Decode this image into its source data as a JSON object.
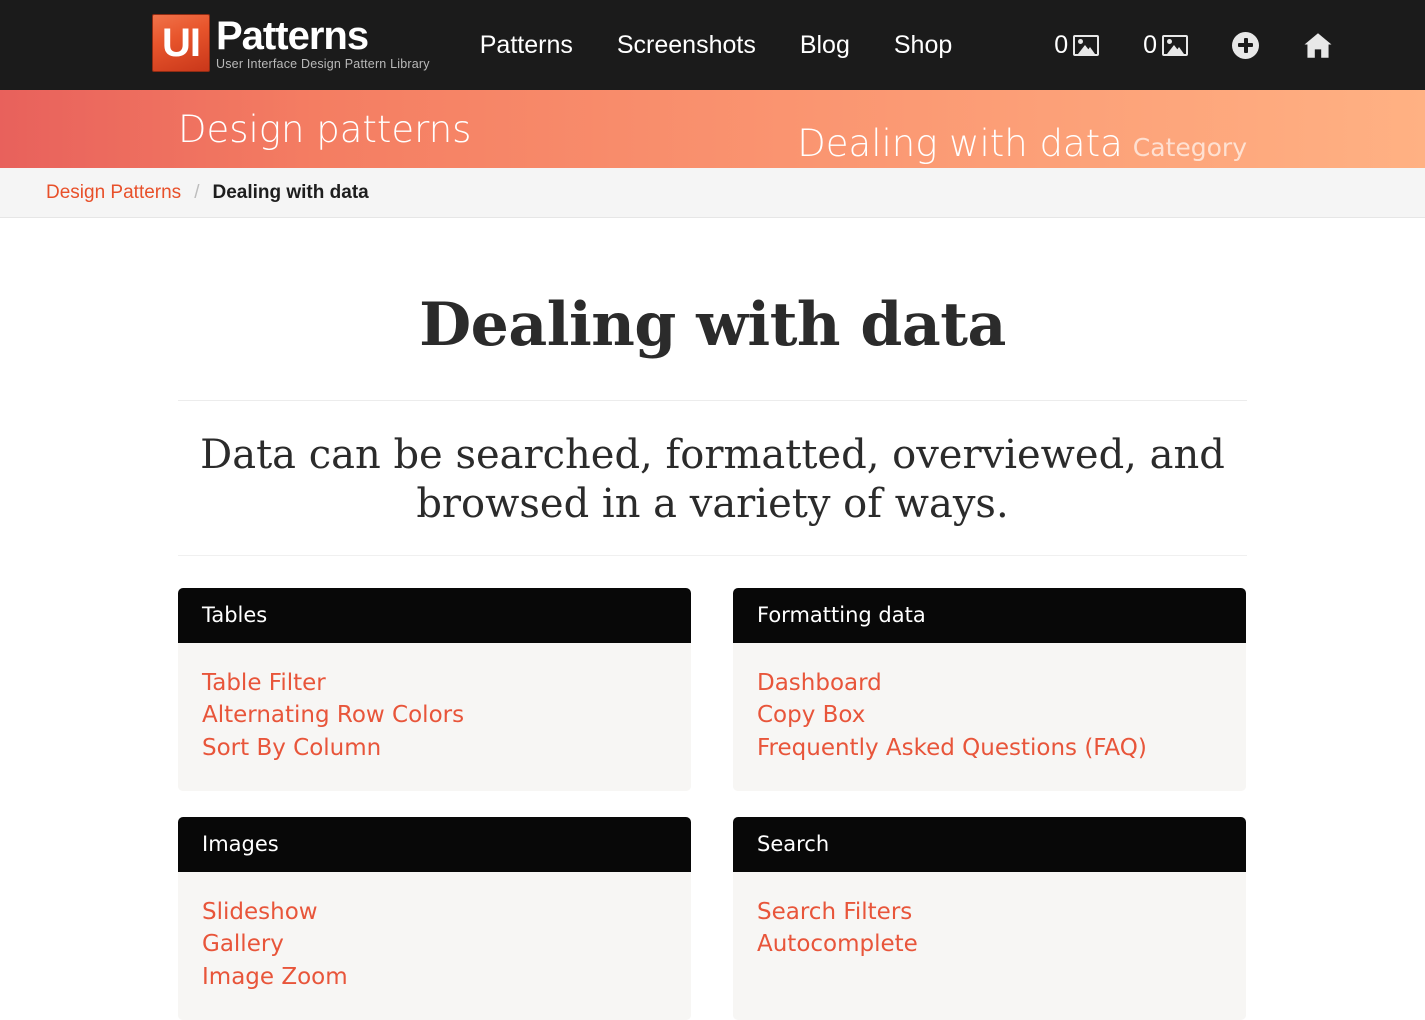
{
  "header": {
    "logo": {
      "mark": "UI",
      "word": "Patterns",
      "tagline": "User Interface Design Pattern Library"
    },
    "nav": [
      {
        "label": "Patterns",
        "name": "nav-patterns"
      },
      {
        "label": "Screenshots",
        "name": "nav-screenshots"
      },
      {
        "label": "Blog",
        "name": "nav-blog"
      },
      {
        "label": "Shop",
        "name": "nav-shop"
      }
    ],
    "counters": [
      {
        "count": "0",
        "icon": "picture-icon"
      },
      {
        "count": "0",
        "icon": "picture-icon"
      }
    ],
    "actions": [
      {
        "icon": "plus-circle-icon",
        "name": "add-button"
      },
      {
        "icon": "home-icon",
        "name": "home-button"
      }
    ],
    "background_color": "#1b1b1b"
  },
  "hero": {
    "left_title": "Design patterns",
    "right_title": "Dealing with data",
    "right_subtitle": "Category",
    "gradient_from": "#e8615c",
    "gradient_to": "#ffb183"
  },
  "breadcrumb": {
    "parent": "Design Patterns",
    "separator": "/",
    "current": "Dealing with data",
    "link_color": "#e8502a"
  },
  "main": {
    "title": "Dealing with data",
    "lead": "Data can be searched, formatted, overviewed, and browsed in a variety of ways.",
    "link_color": "#e8553a",
    "panels": [
      {
        "title": "Tables",
        "links": [
          "Table Filter",
          "Alternating Row Colors",
          "Sort By Column"
        ]
      },
      {
        "title": "Formatting data",
        "links": [
          "Dashboard",
          "Copy Box",
          "Frequently Asked Questions (FAQ)"
        ]
      },
      {
        "title": "Images",
        "links": [
          "Slideshow",
          "Gallery",
          "Image Zoom"
        ]
      },
      {
        "title": "Search",
        "links": [
          "Search Filters",
          "Autocomplete"
        ]
      }
    ]
  }
}
